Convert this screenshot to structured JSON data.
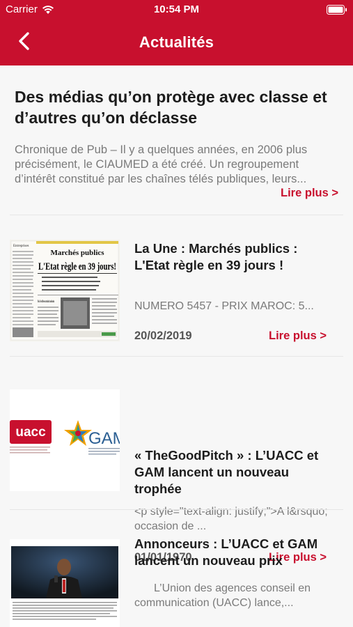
{
  "status_bar": {
    "carrier": "Carrier",
    "time": "10:54 PM"
  },
  "nav": {
    "title": "Actualités"
  },
  "featured": {
    "title": "Des médias qu’on protège avec classe et d’autres qu’on déclasse",
    "excerpt": "Chronique de Pub – Il y a quelques années, en 2006 plus précisément, le CIAUMED a été créé. Un regroupement d’intérêt constitué par les chaînes télés publiques, leurs...",
    "more_label": "Lire plus >"
  },
  "articles": [
    {
      "title": "La Une : Marchés publics : L'Etat règle en 39 jours !",
      "excerpt": "NUMERO 5457 - PRIX MAROC: 5...",
      "date": "20/02/2019",
      "more_label": "Lire plus >",
      "thumb": {
        "headline_top": "Marchés publics",
        "headline_main": "L'Etat règle en 39 jours!",
        "subhead": "Pièce: Des chiffres en attendant la valorisation",
        "paper_name": "Entreprises"
      }
    },
    {
      "title": "« TheGoodPitch » : L’UACC et GAM lancent un nouveau trophée",
      "excerpt": "<p style=\"text-align: justify;\">A l&rsquo;occasion de ...",
      "date": "01/01/1970",
      "more_label": "Lire plus >",
      "thumb": {
        "logo_left": "uacc",
        "logo_right": "GAM"
      }
    },
    {
      "title": "Annonceurs : L’UACC et GAM lancent un nouveau prix",
      "excerpt": "L’Union des agences conseil en communication (UACC) lance,...",
      "date": "",
      "more_label": "",
      "thumb": {}
    }
  ],
  "colors": {
    "brand": "#c8102e",
    "text": "#1c1c1c",
    "muted": "#7a7a7a",
    "background": "#f7f7f7"
  }
}
